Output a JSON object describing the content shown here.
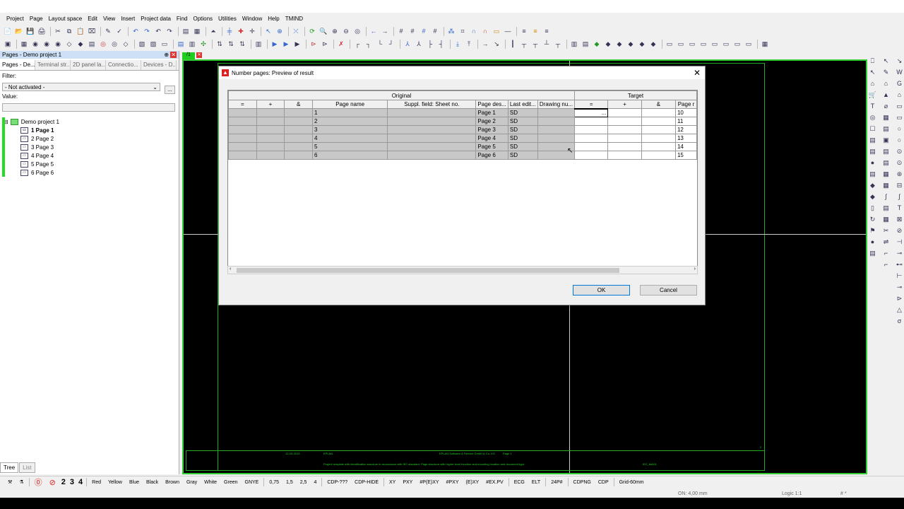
{
  "menu": [
    "Project",
    "Page",
    "Layout space",
    "Edit",
    "View",
    "Insert",
    "Project data",
    "Find",
    "Options",
    "Utilities",
    "Window",
    "Help",
    "TMIND"
  ],
  "toolbar1": [
    [
      "📄",
      ""
    ],
    [
      "📂",
      ""
    ],
    [
      "💾",
      ""
    ],
    [
      "🖨",
      ""
    ],
    [
      "|",
      ""
    ],
    [
      "✂",
      ""
    ],
    [
      "⧉",
      ""
    ],
    [
      "📋",
      ""
    ],
    [
      "⌧",
      ""
    ],
    [
      "|",
      ""
    ],
    [
      "✎",
      ""
    ],
    [
      "✓",
      ""
    ],
    [
      "|",
      ""
    ],
    [
      "↶",
      "b"
    ],
    [
      "↷",
      "b"
    ],
    [
      "↶",
      ""
    ],
    [
      "↷",
      ""
    ],
    [
      "|",
      ""
    ],
    [
      "▤",
      ""
    ],
    [
      "▦",
      ""
    ],
    [
      "|",
      ""
    ],
    [
      "⏶",
      ""
    ],
    [
      "|",
      ""
    ],
    [
      "╪",
      "b"
    ],
    [
      "✚",
      "r"
    ],
    [
      "✛",
      ""
    ],
    [
      "|",
      ""
    ],
    [
      "↖",
      "b"
    ],
    [
      "⊕",
      "b"
    ],
    [
      "|",
      ""
    ],
    [
      "⤫",
      "b"
    ],
    [
      "|",
      ""
    ],
    [
      "⟳",
      "g"
    ],
    [
      "🔍",
      ""
    ],
    [
      "⊕",
      ""
    ],
    [
      "⊖",
      ""
    ],
    [
      "◎",
      ""
    ],
    [
      "|",
      ""
    ],
    [
      "←",
      "b"
    ],
    [
      "→",
      ""
    ],
    [
      "|",
      ""
    ],
    [
      "#",
      ""
    ],
    [
      "#",
      ""
    ],
    [
      "#",
      "b"
    ],
    [
      "#",
      ""
    ],
    [
      "|",
      ""
    ],
    [
      "⁂",
      "b"
    ],
    [
      "⌗",
      ""
    ],
    [
      "∩",
      "b"
    ],
    [
      "∩",
      "r"
    ],
    [
      "▭",
      "o"
    ],
    [
      "—",
      ""
    ],
    [
      "|",
      ""
    ],
    [
      "≡",
      ""
    ],
    [
      "≡",
      "o"
    ],
    [
      "≡",
      ""
    ]
  ],
  "toolbar2": [
    [
      "▣",
      ""
    ],
    [
      "|",
      ""
    ],
    [
      "▦",
      ""
    ],
    [
      "◉",
      ""
    ],
    [
      "◉",
      ""
    ],
    [
      "◉",
      ""
    ],
    [
      "◇",
      ""
    ],
    [
      "◆",
      ""
    ],
    [
      "▤",
      ""
    ],
    [
      "◎",
      "r"
    ],
    [
      "◎",
      ""
    ],
    [
      "◇",
      ""
    ],
    [
      "|",
      ""
    ],
    [
      "▧",
      ""
    ],
    [
      "▨",
      ""
    ],
    [
      "▭",
      ""
    ],
    [
      "|",
      ""
    ],
    [
      "▤",
      "b"
    ],
    [
      "▥",
      ""
    ],
    [
      "✣",
      "g"
    ],
    [
      "|",
      ""
    ],
    [
      "⇅",
      ""
    ],
    [
      "⇅",
      ""
    ],
    [
      "⇅",
      ""
    ],
    [
      "|",
      ""
    ],
    [
      "▥",
      ""
    ],
    [
      "|",
      ""
    ],
    [
      "▶",
      "b"
    ],
    [
      "▶",
      "b"
    ],
    [
      "▶",
      ""
    ],
    [
      "|",
      ""
    ],
    [
      "⊳",
      "r"
    ],
    [
      "⊳",
      ""
    ],
    [
      "|",
      ""
    ],
    [
      "✗",
      "r"
    ],
    [
      "|",
      ""
    ],
    [
      "┌",
      ""
    ],
    [
      "┐",
      ""
    ],
    [
      "└",
      ""
    ],
    [
      "┘",
      ""
    ],
    [
      "|",
      ""
    ],
    [
      "⅄",
      "b"
    ],
    [
      "⅄",
      ""
    ],
    [
      "├",
      ""
    ],
    [
      "┤",
      ""
    ],
    [
      "|",
      ""
    ],
    [
      "⤓",
      "b"
    ],
    [
      "⤒",
      ""
    ],
    [
      "|",
      ""
    ],
    [
      "→",
      ""
    ],
    [
      "↘",
      ""
    ],
    [
      "|",
      ""
    ],
    [
      "┃",
      ""
    ],
    [
      "┬",
      ""
    ],
    [
      "┬",
      ""
    ],
    [
      "┴",
      ""
    ],
    [
      "┬",
      ""
    ],
    [
      "|",
      ""
    ],
    [
      "▥",
      ""
    ],
    [
      "▤",
      ""
    ],
    [
      "◆",
      "g"
    ],
    [
      "◆",
      ""
    ],
    [
      "◆",
      ""
    ],
    [
      "◆",
      ""
    ],
    [
      "◆",
      ""
    ],
    [
      "◆",
      ""
    ],
    [
      "|",
      ""
    ],
    [
      "▭",
      ""
    ],
    [
      "▭",
      ""
    ],
    [
      "▭",
      ""
    ],
    [
      "▭",
      ""
    ],
    [
      "▭",
      ""
    ],
    [
      "▭",
      ""
    ],
    [
      "▭",
      ""
    ],
    [
      "▭",
      ""
    ],
    [
      "|",
      ""
    ],
    [
      "▦",
      ""
    ]
  ],
  "left_panel": {
    "title": "Pages - Demo project 1",
    "tabs": [
      "Pages - De...",
      "Terminal str...",
      "2D panel la...",
      "Connectio...",
      "Devices - D..."
    ],
    "filter_label": "Filter:",
    "filter_value": "- Not activated -",
    "filter_button": "...",
    "value_label": "Value:",
    "project": "Demo project 1",
    "pages": [
      "1 Page 1",
      "2 Page 2",
      "3 Page 3",
      "4 Page 4",
      "5 Page 5",
      "6 Page 6"
    ],
    "bottom_tabs": [
      "Tree",
      "List"
    ]
  },
  "canvas_tab": "/1",
  "dialog": {
    "title": "Number pages: Preview of result",
    "group_original": "Original",
    "group_target": "Target",
    "columns_original": [
      "=",
      "+",
      "&",
      "Page name",
      "Suppl. field: Sheet no.",
      "Page des...",
      "Last edit...",
      "Drawing nu..."
    ],
    "columns_target": [
      "=",
      "+",
      "&",
      "Page r"
    ],
    "rows": [
      {
        "page_name": "1",
        "sheet": "",
        "desc": "Page 1",
        "last": "SD",
        "drawing": "",
        "t_eq": "...",
        "t_plus": "",
        "t_amp": "",
        "t_page": "10"
      },
      {
        "page_name": "2",
        "sheet": "",
        "desc": "Page 2",
        "last": "SD",
        "drawing": "",
        "t_eq": "",
        "t_plus": "",
        "t_amp": "",
        "t_page": "11"
      },
      {
        "page_name": "3",
        "sheet": "",
        "desc": "Page 3",
        "last": "SD",
        "drawing": "",
        "t_eq": "",
        "t_plus": "",
        "t_amp": "",
        "t_page": "12"
      },
      {
        "page_name": "4",
        "sheet": "",
        "desc": "Page 4",
        "last": "SD",
        "drawing": "",
        "t_eq": "",
        "t_plus": "",
        "t_amp": "",
        "t_page": "13"
      },
      {
        "page_name": "5",
        "sheet": "",
        "desc": "Page 5",
        "last": "SD",
        "drawing": "",
        "t_eq": "",
        "t_plus": "",
        "t_amp": "",
        "t_page": "14"
      },
      {
        "page_name": "6",
        "sheet": "",
        "desc": "Page 6",
        "last": "SD",
        "drawing": "",
        "t_eq": "",
        "t_plus": "",
        "t_amp": "",
        "t_page": "15"
      }
    ],
    "ok_label": "OK",
    "cancel_label": "Cancel",
    "close_glyph": "✕"
  },
  "title_block": {
    "company": "EPLAN",
    "address": "EPLAN Software & Service GmbH & Co. KG",
    "page": "Page 1",
    "desc": "Project template with identification structure in accordance with IEC standard: Page structure with higher-level function and mounting location and document type",
    "code": "IEC_bk001",
    "date": "12-03-2015",
    "sheet": "2"
  },
  "status": {
    "pages": [
      "2",
      "3",
      "4"
    ],
    "colors": [
      "Red",
      "Yellow",
      "Blue",
      "Black",
      "Brown",
      "Gray",
      "White",
      "Green",
      "GNYE"
    ],
    "widths": [
      "0,75",
      "1,5",
      "2,5",
      "4"
    ],
    "cdp": [
      "CDP-???",
      "CDP-HIDE"
    ],
    "coords": [
      "XY",
      "PXY",
      "#P(E)XY",
      "#PXY",
      "(E)XY",
      "#EX.PV"
    ],
    "modes": [
      "ECG",
      "ELT"
    ],
    "p24": "24P#",
    "cdpng": [
      "CDPNG",
      "CDP"
    ],
    "grid": "Grid-60mm",
    "on": "ON: 4,00 mm",
    "logic": "Logic 1:1",
    "hash": "# *"
  },
  "right_icons_col1": [
    "⎕",
    "↖",
    "⌂",
    "🛒",
    "T",
    "◎",
    "☐",
    "▤",
    "▤",
    "●",
    "▤",
    "◆",
    "◆",
    "▯",
    "↻",
    "⚑",
    "●",
    "▤"
  ],
  "right_icons_col2": [
    "↖",
    "✎",
    "⌂",
    "▲",
    "⌀",
    "▦",
    "▤",
    "▣",
    "▤",
    "▤",
    "▦",
    "▦",
    "∫",
    "▤",
    "▦",
    "✂",
    "⇌",
    "⌐",
    "⌐"
  ],
  "right_icons_col3": [
    "↘",
    "W",
    "G",
    "⌂",
    "▭",
    "▭",
    "○",
    "○",
    "⊙",
    "⊙",
    "⊛",
    "⊟",
    "∫",
    "T",
    "⊠",
    "⊘",
    "⊣",
    "⊸",
    "⊷",
    "⊢",
    "⊸",
    "⊳",
    "△",
    "σ"
  ]
}
